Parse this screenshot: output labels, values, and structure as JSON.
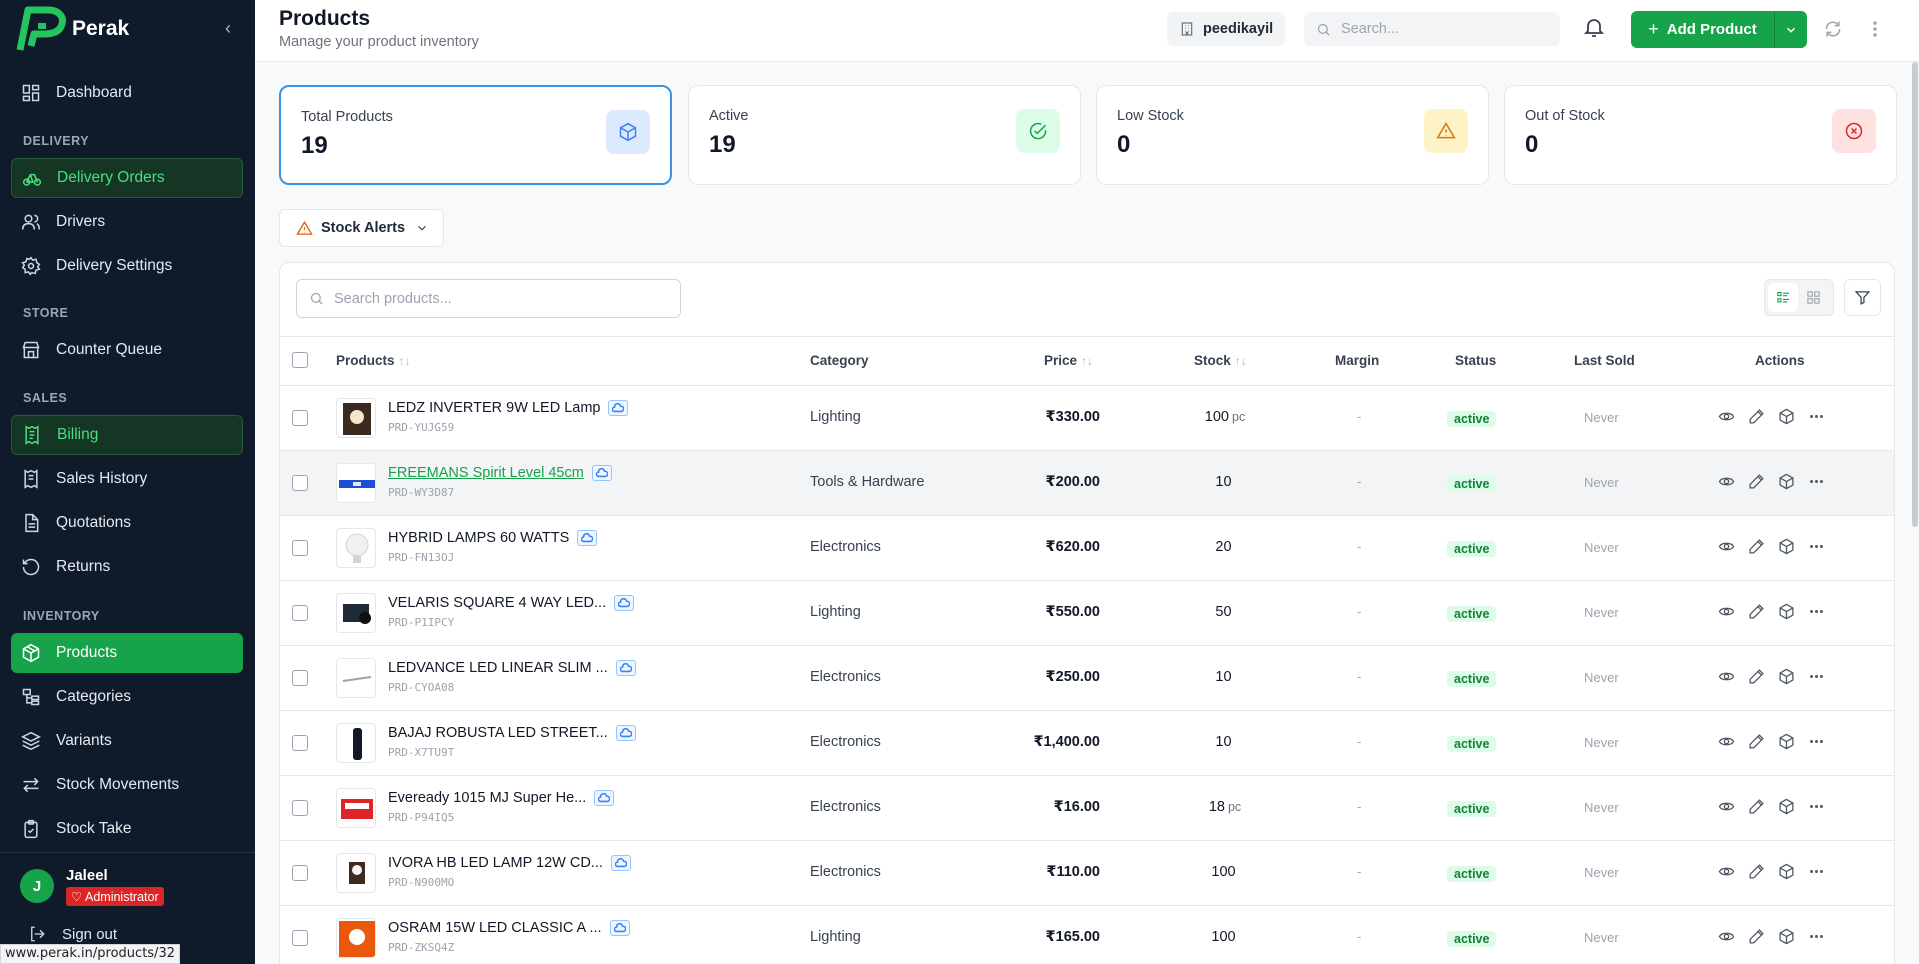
{
  "sidebar": {
    "brand": "Perak",
    "sections": {
      "delivery": "DELIVERY",
      "store": "STORE",
      "sales": "SALES",
      "inventory": "INVENTORY"
    },
    "items": {
      "dashboard": "Dashboard",
      "delivery_orders": "Delivery Orders",
      "drivers": "Drivers",
      "delivery_settings": "Delivery Settings",
      "counter_queue": "Counter Queue",
      "billing": "Billing",
      "sales_history": "Sales History",
      "quotations": "Quotations",
      "returns": "Returns",
      "products": "Products",
      "categories": "Categories",
      "variants": "Variants",
      "stock_movements": "Stock Movements",
      "stock_take": "Stock Take"
    },
    "user": {
      "initial": "J",
      "name": "Jaleel",
      "role": "Administrator"
    },
    "signout": "Sign out"
  },
  "status_url": "www.perak.in/products/32",
  "header": {
    "title": "Products",
    "subtitle": "Manage your product inventory",
    "store": "peedikayil",
    "search_placeholder": "Search...",
    "add_label": "Add Product"
  },
  "stats": [
    {
      "label": "Total Products",
      "value": "19",
      "icon": "box-icon",
      "color": "#3b82f6",
      "bg": "#dbeafe"
    },
    {
      "label": "Active",
      "value": "19",
      "icon": "check-circle-icon",
      "color": "#16a34a",
      "bg": "#dcfce7"
    },
    {
      "label": "Low Stock",
      "value": "0",
      "icon": "warning-icon",
      "color": "#d97706",
      "bg": "#fef3c7"
    },
    {
      "label": "Out of Stock",
      "value": "0",
      "icon": "x-circle-icon",
      "color": "#dc2626",
      "bg": "#fee2e2"
    }
  ],
  "alerts_label": "Stock Alerts",
  "table": {
    "search_placeholder": "Search products...",
    "columns": {
      "products": "Products",
      "category": "Category",
      "price": "Price",
      "stock": "Stock",
      "margin": "Margin",
      "status": "Status",
      "last_sold": "Last Sold",
      "actions": "Actions"
    },
    "rows": [
      {
        "name": "LEDZ INVERTER 9W LED Lamp",
        "sku": "PRD-YUJG59",
        "category": "Lighting",
        "price": "₹330.00",
        "stock": "100",
        "unit": "pc",
        "margin": "-",
        "status": "active",
        "last_sold": "Never"
      },
      {
        "name": "FREEMANS Spirit Level 45cm",
        "sku": "PRD-WY3D87",
        "category": "Tools & Hardware",
        "price": "₹200.00",
        "stock": "10",
        "unit": "",
        "margin": "-",
        "status": "active",
        "last_sold": "Never"
      },
      {
        "name": "HYBRID LAMPS 60 WATTS",
        "sku": "PRD-FN13OJ",
        "category": "Electronics",
        "price": "₹620.00",
        "stock": "20",
        "unit": "",
        "margin": "-",
        "status": "active",
        "last_sold": "Never"
      },
      {
        "name": "VELARIS SQUARE 4 WAY LED...",
        "sku": "PRD-P1IPCY",
        "category": "Lighting",
        "price": "₹550.00",
        "stock": "50",
        "unit": "",
        "margin": "-",
        "status": "active",
        "last_sold": "Never"
      },
      {
        "name": "LEDVANCE LED LINEAR SLIM ...",
        "sku": "PRD-CYOA08",
        "category": "Electronics",
        "price": "₹250.00",
        "stock": "10",
        "unit": "",
        "margin": "-",
        "status": "active",
        "last_sold": "Never"
      },
      {
        "name": "BAJAJ ROBUSTA LED STREET...",
        "sku": "PRD-X7TU9T",
        "category": "Electronics",
        "price": "₹1,400.00",
        "stock": "10",
        "unit": "",
        "margin": "-",
        "status": "active",
        "last_sold": "Never"
      },
      {
        "name": "Eveready 1015 MJ Super He...",
        "sku": "PRD-P94IQ5",
        "category": "Electronics",
        "price": "₹16.00",
        "stock": "18",
        "unit": "pc",
        "margin": "-",
        "status": "active",
        "last_sold": "Never"
      },
      {
        "name": "IVORA HB LED LAMP 12W CD...",
        "sku": "PRD-N900MO",
        "category": "Electronics",
        "price": "₹110.00",
        "stock": "100",
        "unit": "",
        "margin": "-",
        "status": "active",
        "last_sold": "Never"
      },
      {
        "name": "OSRAM 15W LED CLASSIC A ...",
        "sku": "PRD-ZKSQ4Z",
        "category": "Lighting",
        "price": "₹165.00",
        "stock": "100",
        "unit": "",
        "margin": "-",
        "status": "active",
        "last_sold": "Never"
      }
    ]
  }
}
